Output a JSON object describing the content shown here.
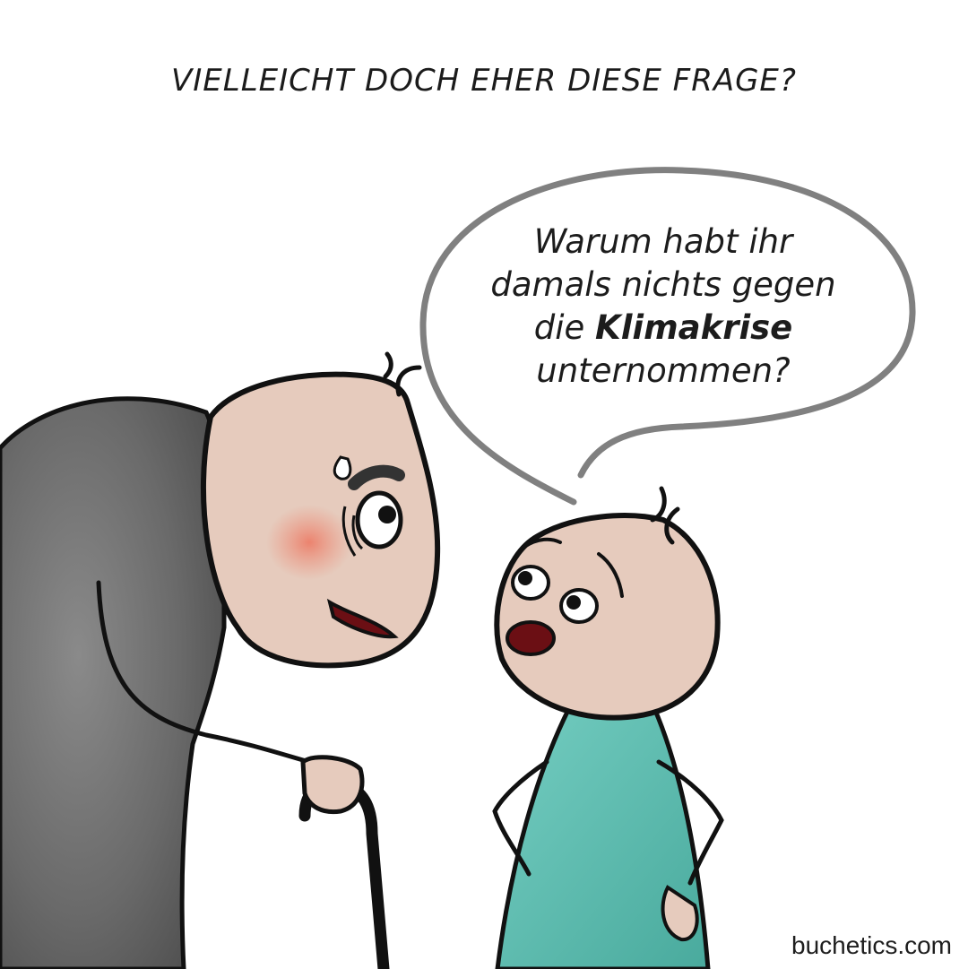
{
  "caption": "VIELLEICHT DOCH EHER DIESE FRAGE?",
  "speech": {
    "line1": "Warum habt ihr",
    "line2": "damals nichts gegen",
    "line3_prefix": "die ",
    "line3_bold": "Klimakrise",
    "line4": "unternommen?"
  },
  "credit": "buchetics.com",
  "colors": {
    "coat": "#6e6e6e",
    "skin": "#e6cbbd",
    "cheek": "#ec8f7a",
    "shirt": "#5fbfb2",
    "outline": "#111111",
    "bubble": "#7f7f7f",
    "mouth": "#6b0f14"
  }
}
